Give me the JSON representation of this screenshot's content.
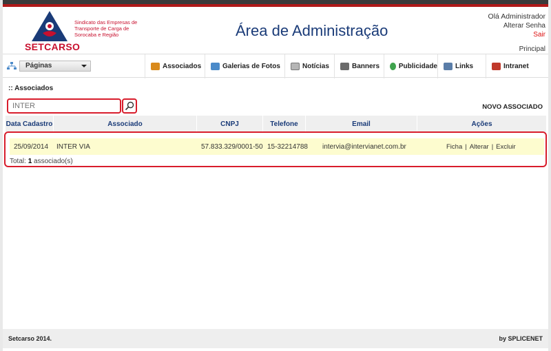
{
  "header": {
    "logo_name": "SETCARSO",
    "logo_tagline": "Sindicato das Empresas de Transporte de Carga de Sorocaba e Região",
    "title": "Área de Administração",
    "greeting": "Olá Administrador",
    "change_password": "Alterar Senha",
    "logout": "Sair",
    "home_link": "Principal"
  },
  "nav": {
    "pages_label": "Páginas",
    "items": [
      {
        "label": "Associados",
        "icon": "handshake-icon",
        "color": "#d98a1c"
      },
      {
        "label": "Galerias de Fotos",
        "icon": "photo-gallery-icon",
        "color": "#4b8ac9"
      },
      {
        "label": "Notícias",
        "icon": "newspaper-icon",
        "color": "#888888"
      },
      {
        "label": "Banners",
        "icon": "banner-icon",
        "color": "#6b6b6b"
      },
      {
        "label": "Publicidade",
        "icon": "publicity-icon",
        "color": "#3fa34d"
      },
      {
        "label": "Links",
        "icon": "links-icon",
        "color": "#5a7da8"
      },
      {
        "label": "Intranet",
        "icon": "intranet-icon",
        "color": "#c0392b"
      }
    ]
  },
  "main": {
    "section_title": ":: Associados",
    "search": {
      "value": "",
      "placeholder": "INTER"
    },
    "new_button": "NOVO ASSOCIADO",
    "columns": [
      "Data Cadastro",
      "Associado",
      "CNPJ",
      "Telefone",
      "Email",
      "Ações"
    ],
    "rows": [
      {
        "date": "25/09/2014",
        "name": "INTER VIA",
        "cnpj": "57.833.329/0001-50",
        "phone": "15-32214788",
        "email": "intervia@intervianet.com.br",
        "actions": [
          "Ficha",
          "Alterar",
          "Excluir"
        ]
      }
    ],
    "total_prefix": "Total:",
    "total_count": "1",
    "total_suffix": "associado(s)"
  },
  "footer": {
    "left": "Setcarso 2014.",
    "right": "by SPLICENET"
  },
  "colors": {
    "accent_red": "#d81c2b",
    "title_blue": "#1a3b78",
    "row_highlight": "#fdfccf"
  }
}
